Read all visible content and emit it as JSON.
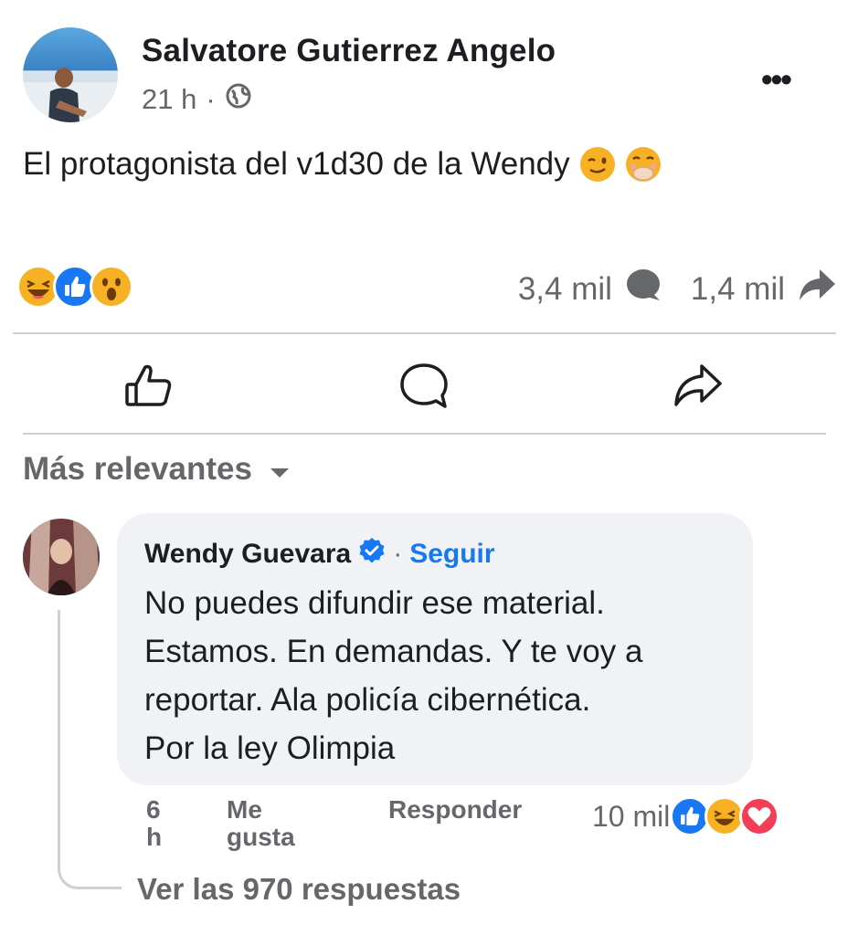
{
  "post": {
    "author": "Salvatore Gutierrez Angelo",
    "time": "21 h",
    "separator": "·",
    "text": "El protagonista del v1d30 de la Wendy",
    "text_emojis": [
      "wink-face-icon",
      "face-with-hand-over-mouth-icon"
    ],
    "reactions": [
      "laughing-face-icon",
      "like-icon",
      "wow-face-icon"
    ],
    "comments_count": "3,4 mil",
    "shares_count": "1,4 mil"
  },
  "sort": {
    "label": "Más relevantes"
  },
  "comment": {
    "author": "Wendy Guevara",
    "separator": "·",
    "follow_label": "Seguir",
    "lines": [
      "No puedes difundir ese material.",
      "Estamos. En demandas. Y te voy a",
      "reportar. Ala policía cibernética.",
      "Por la ley Olimpia"
    ],
    "time_line1": "6",
    "time_line2": "h",
    "like_line1": "Me",
    "like_line2": "gusta",
    "reply_label": "Responder",
    "reactions_count": "10 mil",
    "reactions": [
      "like-icon",
      "laughing-face-icon",
      "love-icon"
    ],
    "view_replies": "Ver las 970 respuestas"
  },
  "colors": {
    "primary_text": "#1c1e21",
    "secondary_text": "#65676b",
    "link_blue": "#1877f2",
    "bubble_bg": "#f0f2f5",
    "divider": "#ced0d4",
    "love_red": "#f33e58",
    "haha_yellow": "#f7b125"
  }
}
